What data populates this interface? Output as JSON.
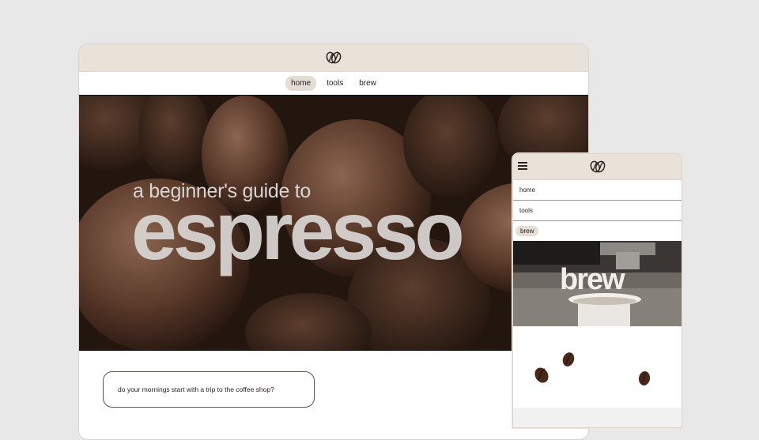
{
  "desktop": {
    "nav": [
      {
        "label": "home",
        "active": true
      },
      {
        "label": "tools",
        "active": false
      },
      {
        "label": "brew",
        "active": false
      }
    ],
    "hero": {
      "subtitle": "a beginner's guide to",
      "title": "espresso"
    },
    "question": "do your mornings start with a trip to the coffee shop?"
  },
  "mobile": {
    "menu": [
      {
        "label": "home"
      },
      {
        "label": "tools"
      }
    ],
    "active_item": "brew",
    "hero_title": "brew"
  },
  "colors": {
    "header_bg": "#e9e2d9",
    "active_pill": "#e3ddd6",
    "hero_dark": "#22160f"
  },
  "icons": [
    "coffee-bean-logo-icon",
    "hamburger-menu-icon"
  ]
}
